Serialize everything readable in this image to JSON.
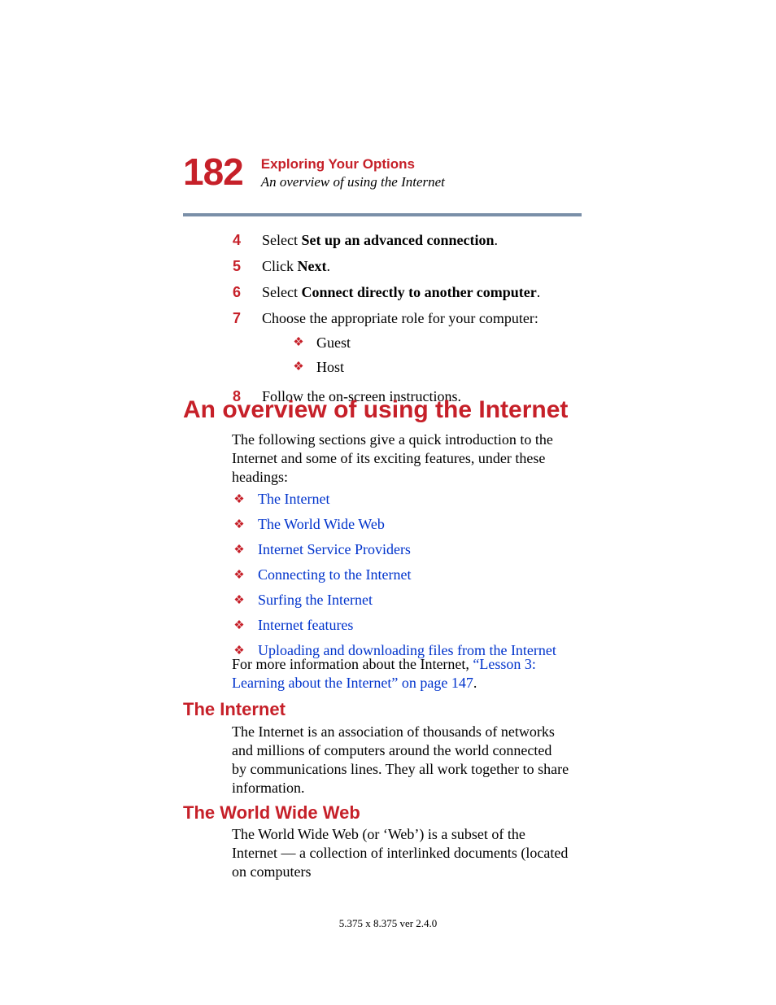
{
  "header": {
    "page_number": "182",
    "chapter_title": "Exploring Your Options",
    "section_title": "An overview of using the Internet"
  },
  "steps": {
    "4": {
      "num": "4",
      "prefix": "Select ",
      "bold": "Set up an advanced connection",
      "suffix": "."
    },
    "5": {
      "num": "5",
      "prefix": "Click ",
      "bold": "Next",
      "suffix": "."
    },
    "6": {
      "num": "6",
      "prefix": "Select ",
      "bold": "Connect directly to another computer",
      "suffix": "."
    },
    "7": {
      "num": "7",
      "text": "Choose the appropriate role for your computer:",
      "sub": [
        "Guest",
        "Host"
      ]
    },
    "8": {
      "num": "8",
      "text": "Follow the on-screen instructions."
    }
  },
  "h1": "An overview of using the Internet",
  "intro": "The following sections give a quick introduction to the Internet and some of its exciting features, under these headings:",
  "links": [
    "The Internet",
    "The World Wide Web",
    "Internet Service Providers",
    "Connecting to the Internet",
    "Surfing the Internet",
    "Internet features",
    "Uploading and downloading files from the Internet"
  ],
  "more_info": {
    "prefix": "For more information about the Internet, ",
    "link": "“Lesson 3: Learning about the Internet” on page 147",
    "suffix": "."
  },
  "sec_internet": {
    "heading": "The Internet",
    "body": "The Internet is an association of thousands of networks and millions of computers around the world connected by communications lines. They all work together to share information."
  },
  "sec_www": {
    "heading": "The World Wide Web",
    "body": "The World Wide Web (or ‘Web’) is a subset of the Internet — a collection of interlinked documents (located on computers"
  },
  "footer": "5.375 x 8.375 ver 2.4.0"
}
